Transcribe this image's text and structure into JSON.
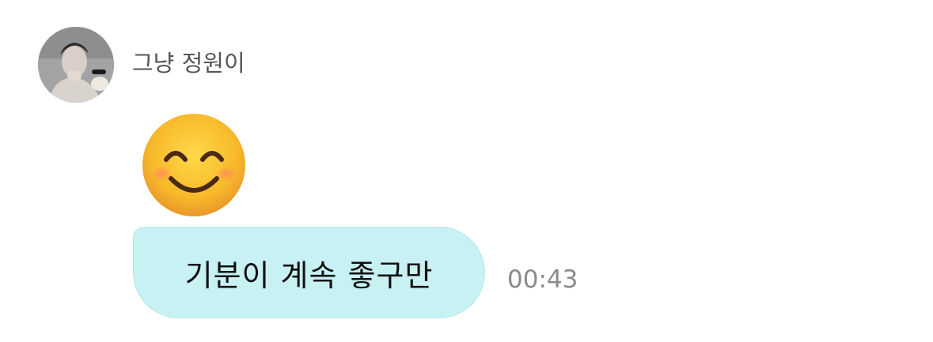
{
  "message": {
    "sender_name": "그냥 정원이",
    "avatar_icon": "profile-photo",
    "emoji_icon": "smiling-face-with-smiling-eyes",
    "text": "기분이 계속 좋구만",
    "time": "00:43"
  },
  "colors": {
    "bubble_background": "#c8f1f4",
    "sender_name": "#555555",
    "timestamp": "#8a8a8a",
    "message_text": "#111111"
  }
}
